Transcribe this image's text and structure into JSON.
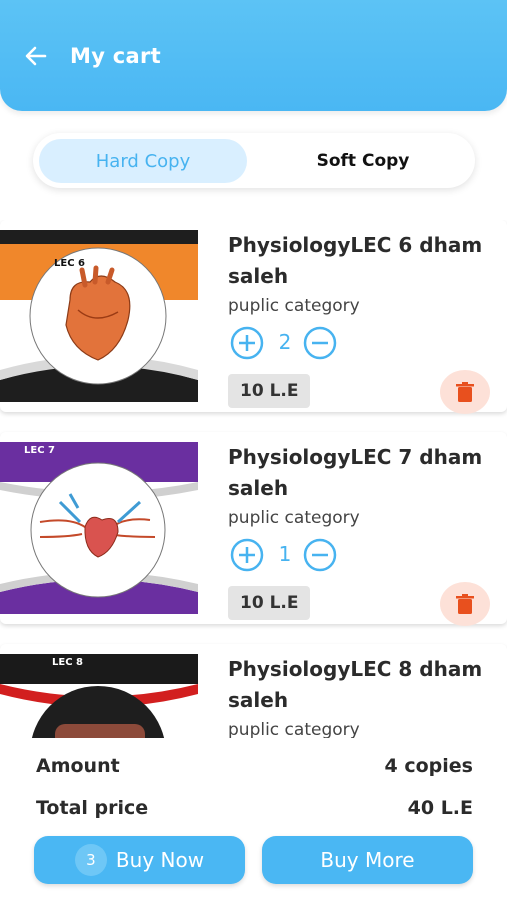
{
  "header": {
    "title": "My cart",
    "back_icon": "arrow-left-icon"
  },
  "tabs": [
    {
      "label": "Hard Copy",
      "selected": true
    },
    {
      "label": "Soft Copy",
      "selected": false
    }
  ],
  "items": [
    {
      "title": "PhysiologyLEC 6  dham saleh",
      "category": "puplic category",
      "quantity": "2",
      "price": "10 L.E",
      "thumb_caption": "LEC 6"
    },
    {
      "title": "PhysiologyLEC 7  dham saleh",
      "category": "puplic category",
      "quantity": "1",
      "price": "10 L.E",
      "thumb_caption": "LEC 7"
    },
    {
      "title": "PhysiologyLEC 8  dham saleh",
      "category": "puplic category",
      "quantity": "",
      "price": "",
      "thumb_caption": "LEC 8"
    }
  ],
  "summary": {
    "amount_label": "Amount",
    "amount_value": "4 copies",
    "total_label": "Total price",
    "total_value": "40 L.E"
  },
  "actions": {
    "buy_now_badge": "3",
    "buy_now_label": "Buy Now",
    "buy_more_label": "Buy More"
  },
  "colors": {
    "primary": "#4ab7f3",
    "selected_tab_bg": "#d9efff",
    "delete_bg": "#fde1d8",
    "delete_icon": "#e8501e"
  }
}
